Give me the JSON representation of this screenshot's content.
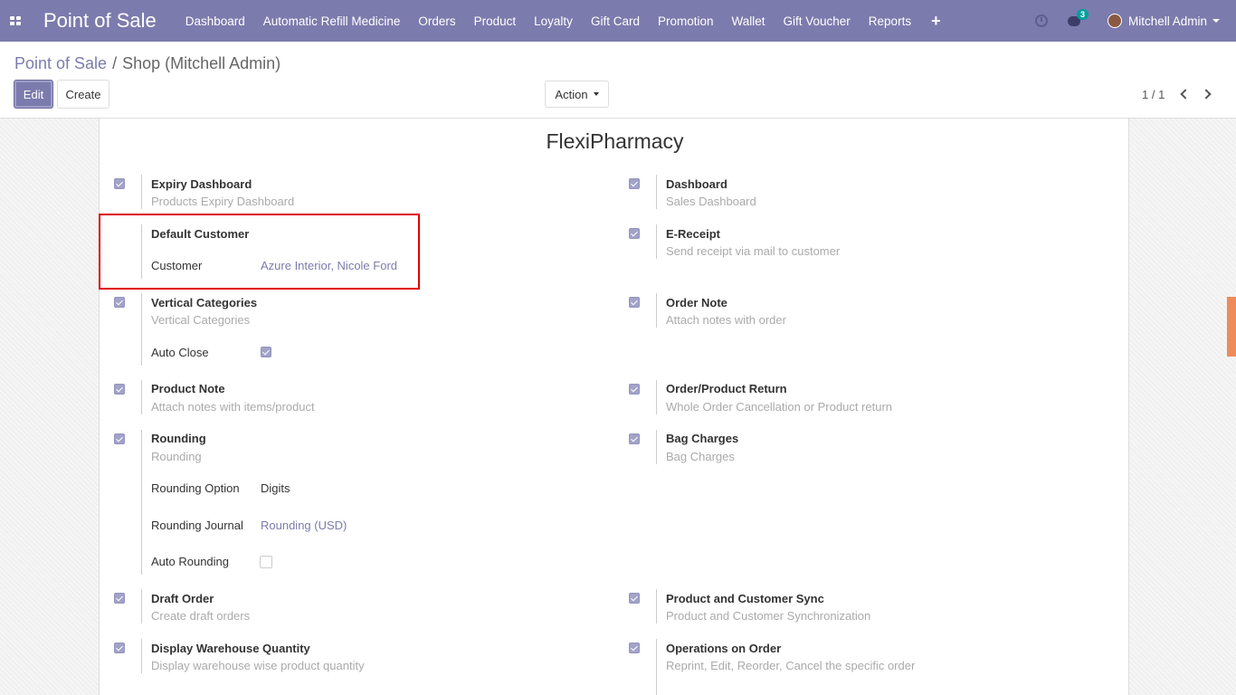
{
  "navbar": {
    "brand": "Point of Sale",
    "menu": [
      "Dashboard",
      "Automatic Refill Medicine",
      "Orders",
      "Product",
      "Loyalty",
      "Gift Card",
      "Promotion",
      "Wallet",
      "Gift Voucher",
      "Reports"
    ],
    "plus": "+",
    "chat_badge": "3",
    "user_name": "Mitchell Admin",
    "color": "#7c7bad"
  },
  "breadcrumb": {
    "parent": "Point of Sale",
    "separator": "/",
    "current": "Shop (Mitchell Admin)"
  },
  "toolbar": {
    "edit_label": "Edit",
    "create_label": "Create",
    "action_label": "Action",
    "pager": "1 / 1"
  },
  "form": {
    "section_title": "FlexiPharmacy",
    "left": {
      "expiry_dashboard": {
        "title": "Expiry Dashboard",
        "desc": "Products Expiry Dashboard",
        "checked": true
      },
      "default_customer": {
        "title": "Default Customer",
        "customer_label": "Customer",
        "customer_value": "Azure Interior, Nicole Ford"
      },
      "vertical_categories": {
        "title": "Vertical Categories",
        "desc": "Vertical Categories",
        "auto_close_label": "Auto Close",
        "checked": true
      },
      "product_note": {
        "title": "Product Note",
        "desc": "Attach notes with items/product",
        "checked": true
      },
      "rounding": {
        "title": "Rounding",
        "desc": "Rounding",
        "option_label": "Rounding Option",
        "option_value": "Digits",
        "journal_label": "Rounding Journal",
        "journal_value": "Rounding (USD)",
        "auto_label": "Auto Rounding",
        "checked": true
      },
      "draft_order": {
        "title": "Draft Order",
        "desc": "Create draft orders",
        "checked": true
      },
      "display_warehouse": {
        "title": "Display Warehouse Quantity",
        "desc": "Display warehouse wise product quantity",
        "checked": true
      }
    },
    "right": {
      "dashboard": {
        "title": "Dashboard",
        "desc": "Sales Dashboard",
        "checked": true
      },
      "e_receipt": {
        "title": "E-Receipt",
        "desc": "Send receipt via mail to customer",
        "checked": true
      },
      "order_note": {
        "title": "Order Note",
        "desc": "Attach notes with order",
        "checked": true
      },
      "order_return": {
        "title": "Order/Product Return",
        "desc": "Whole Order Cancellation or Product return",
        "checked": true
      },
      "bag_charges": {
        "title": "Bag Charges",
        "desc": "Bag Charges",
        "checked": true
      },
      "product_sync": {
        "title": "Product and Customer Sync",
        "desc": "Product and Customer Synchronization",
        "checked": true
      },
      "operations": {
        "title": "Operations on Order",
        "desc": "Reprint, Edit, Reorder, Cancel the specific order",
        "checked": true
      }
    }
  }
}
